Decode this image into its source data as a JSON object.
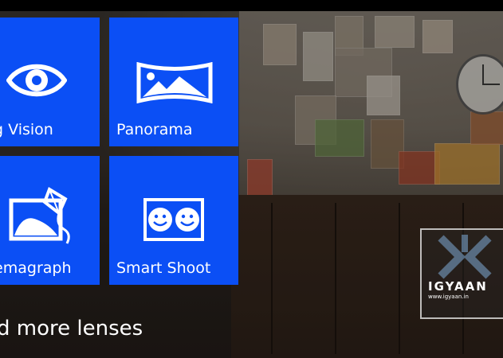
{
  "lenses": [
    {
      "label": "ng Vision",
      "icon": "eye-icon"
    },
    {
      "label": "Panorama",
      "icon": "panorama-icon"
    },
    {
      "label": "nemagraph",
      "icon": "cinemagraph-icon"
    },
    {
      "label": "Smart Shoot",
      "icon": "smiley-faces-icon"
    }
  ],
  "footer": {
    "link": "d more lenses"
  },
  "watermark": {
    "name": "IGYAAN",
    "url": "www.igyaan.in"
  },
  "colors": {
    "tile": "#0b4ff5",
    "text": "#ffffff"
  }
}
